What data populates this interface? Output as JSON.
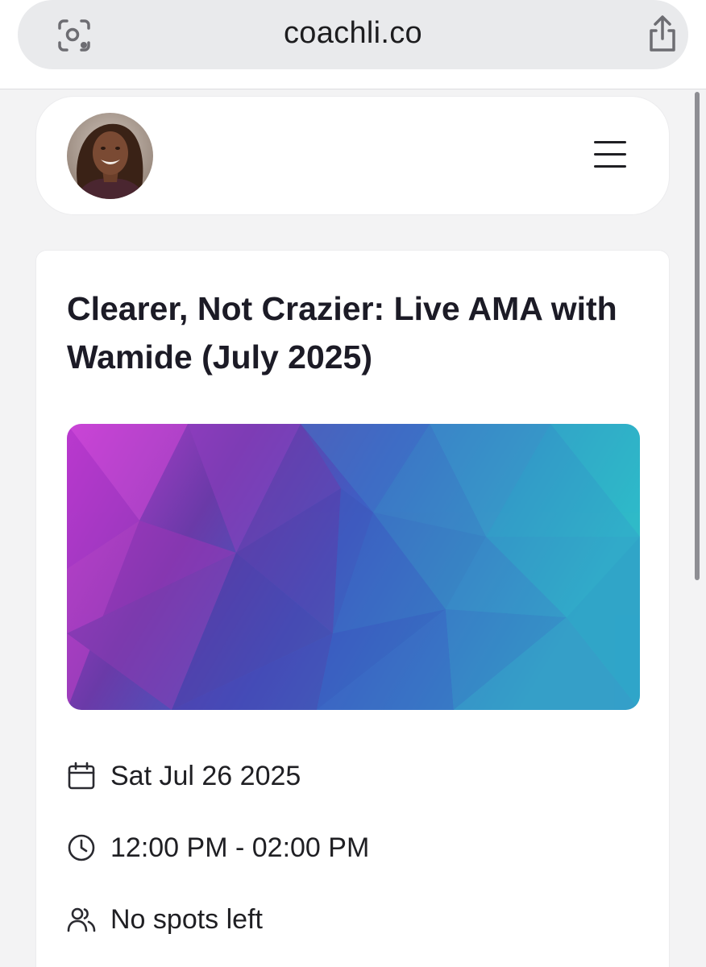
{
  "browser": {
    "url": "coachli.co",
    "lens_icon": "camera-lens-icon",
    "share_icon": "share-icon"
  },
  "site_header": {
    "avatar_alt": "coach-avatar",
    "menu_icon": "hamburger-menu-icon"
  },
  "event": {
    "title": "Clearer, Not Crazier: Live AMA with Wamide (July 2025)",
    "cover_colors": [
      "#c23ed6",
      "#5a3fb0",
      "#3e5fc4",
      "#2fb9c9"
    ],
    "date": "Sat Jul 26 2025",
    "time": "12:00 PM - 02:00 PM",
    "availability": "No spots left",
    "date_icon": "calendar-icon",
    "time_icon": "clock-icon",
    "availability_icon": "users-icon"
  }
}
